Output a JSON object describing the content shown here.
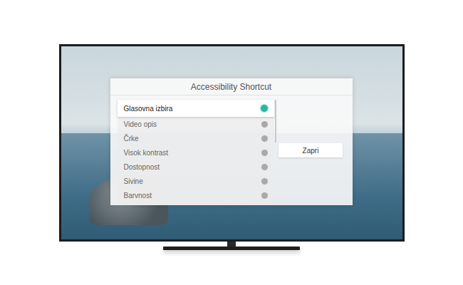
{
  "dialog": {
    "title": "Accessibility Shortcut"
  },
  "items": [
    {
      "label": "Glasovna izbira",
      "selected": true
    },
    {
      "label": "Video opis",
      "selected": false
    },
    {
      "label": "Črke",
      "selected": false
    },
    {
      "label": "Visok kontrast",
      "selected": false
    },
    {
      "label": "Dostopnost",
      "selected": false
    },
    {
      "label": "Sivine",
      "selected": false
    },
    {
      "label": "Barvnost",
      "selected": false
    }
  ],
  "buttons": [
    "Zapri"
  ]
}
